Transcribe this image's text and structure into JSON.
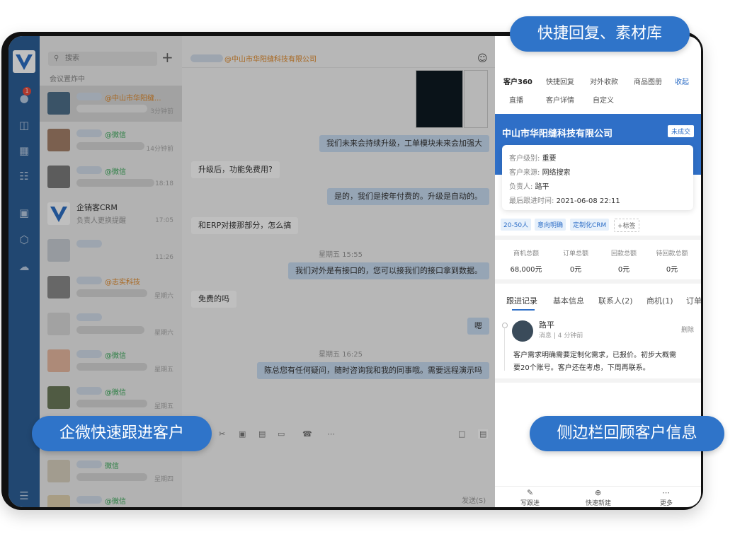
{
  "callouts": {
    "quick_reply": "快捷回复、素材库",
    "wechat_follow": "企微快速跟进客户",
    "sidebar_review": "侧边栏回顾客户信息"
  },
  "list": {
    "search_placeholder": "搜索",
    "meeting": "会议置炸中",
    "items": [
      {
        "tag": "@中山市华阳缝...",
        "time": "3分钟前"
      },
      {
        "tag": "@微信",
        "time": "14分钟前"
      },
      {
        "tag": "@微信",
        "time": "18:18"
      },
      {
        "name": "企销客CRM",
        "sub": "负责人更换提醒",
        "time": "17:05"
      },
      {
        "tag": "",
        "time": "11:26"
      },
      {
        "tag": "@志实科技",
        "time": "星期六"
      },
      {
        "tag": "",
        "time": "星期六"
      },
      {
        "tag": "@微信",
        "time": "星期五"
      },
      {
        "tag": "@微信",
        "time": "星期五"
      },
      {
        "tag": "微信",
        "time": "星期四"
      },
      {
        "tag": "@微信",
        "time": "星期四"
      }
    ],
    "badge": "1"
  },
  "chat": {
    "company": "@中山市华阳缝科技有限公司",
    "messages": [
      {
        "text": "我们未来会持续升级，工单模块未来会加强大"
      },
      {
        "text": "升级后，功能免费用?"
      },
      {
        "text": "是的，我们是按年付费的。升级是自动的。"
      },
      {
        "text": "和ERP对接那部分，怎么搞"
      },
      {
        "text": "星期五 15:55"
      },
      {
        "text": "我们对外是有接口的，您可以接我们的接口拿到数据。"
      },
      {
        "text": "免费的吗"
      },
      {
        "text": "嗯"
      },
      {
        "text": "星期五 16:25"
      },
      {
        "text": "陈总您有任何疑问，随时咨询我和我的同事哦。需要远程演示吗"
      }
    ],
    "send": "发送(S)"
  },
  "side": {
    "tabs": [
      "客户360",
      "快捷回复",
      "对外收款",
      "商品图册",
      "收起",
      "直播",
      "客户详情",
      "自定义"
    ],
    "company": "中山市华阳缝科技有限公司",
    "status": "未成交",
    "fields": [
      {
        "k": "客户级别:",
        "v": "重要"
      },
      {
        "k": "客户来源:",
        "v": "网络搜索"
      },
      {
        "k": "负责人:",
        "v": "路平"
      },
      {
        "k": "最后跟进时间:",
        "v": "2021-06-08 22:11"
      }
    ],
    "chips": [
      "20-50人",
      "意向明确",
      "定制化CRM",
      "+标签"
    ],
    "stats": [
      {
        "l": "商机总额",
        "v": "68,000元"
      },
      {
        "l": "订单总额",
        "v": "0元"
      },
      {
        "l": "回款总额",
        "v": "0元"
      },
      {
        "l": "待回款总额",
        "v": "0元"
      }
    ],
    "ftabs": [
      "跟进记录",
      "基本信息",
      "联系人(2)",
      "商机(1)",
      "订单"
    ],
    "record": {
      "name": "路平",
      "meta": "消息 | 4 分钟前",
      "delete": "删除",
      "text1": "客户需求明确需要定制化需求，已报价。初步大概需",
      "text2": "要20个账号。客户还在考虑，下周再联系。"
    },
    "bottom": [
      "写跟进",
      "快速新建",
      "更多"
    ]
  },
  "colors": {
    "accent": "#2f74c9",
    "nav": "#2c5f97"
  }
}
